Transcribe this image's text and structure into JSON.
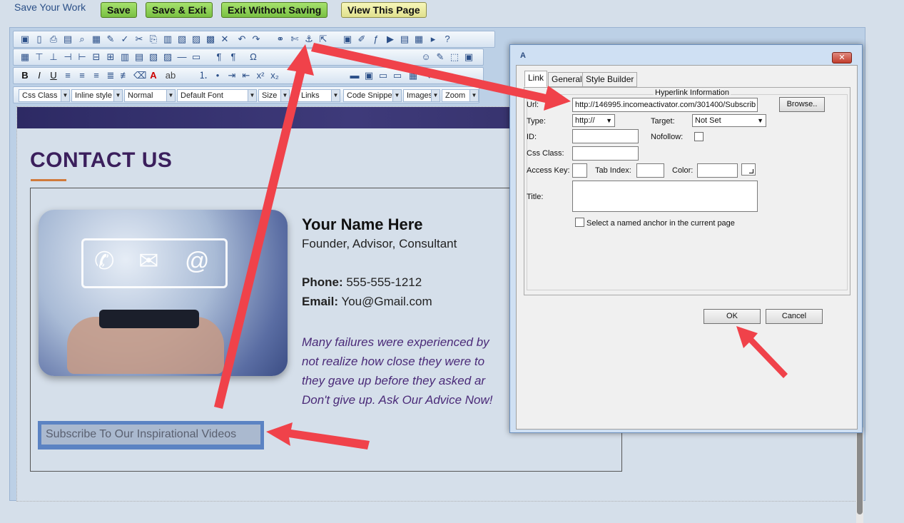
{
  "topbar": {
    "save_work": "Save Your Work",
    "buttons": {
      "save": "Save",
      "save_exit": "Save & Exit",
      "exit_no_save": "Exit Without Saving",
      "view_page": "View This Page"
    }
  },
  "toolbar": {
    "css_class": "Css Class",
    "inline_style": "Inline style",
    "paragraph": "Normal",
    "font": "Default Font",
    "size": "Size",
    "links": "Links",
    "code_snippet": "Code Snippet",
    "images": "Images",
    "zoom": "Zoom"
  },
  "page": {
    "title": "CONTACT US",
    "name": "Your Name Here",
    "roles": "Founder, Advisor, Consultant",
    "phone_label": "Phone:",
    "phone": "555-555-1212",
    "email_label": "Email:",
    "email": "You@Gmail.com",
    "quote": [
      "Many failures were experienced by",
      "not realize how close they were to",
      "they gave up before they asked ar",
      "Don't give up. Ask Our Advice Now!"
    ],
    "subscribe": "Subscribe To Our Inspirational Videos"
  },
  "dialog": {
    "title": "A",
    "tabs": [
      "Link",
      "General",
      "Style Builder"
    ],
    "legend": "Hyperlink Information",
    "url_label": "Url:",
    "url_value": "http://146995.incomeactivator.com/301400/Subscrib",
    "browse": "Browse..",
    "type_label": "Type:",
    "type_value": "http://",
    "target_label": "Target:",
    "target_value": "Not Set",
    "id_label": "ID:",
    "nofollow_label": "Nofollow:",
    "css_class_label": "Css Class:",
    "access_key_label": "Access Key:",
    "tab_index_label": "Tab Index:",
    "color_label": "Color:",
    "title_label": "Title:",
    "named_anchor": "Select a named anchor in the current page",
    "ok": "OK",
    "cancel": "Cancel"
  },
  "colors": {
    "annotation_arrow": "#f0424a",
    "accent_title": "#3b1f5c",
    "underline": "#d07a3b"
  }
}
